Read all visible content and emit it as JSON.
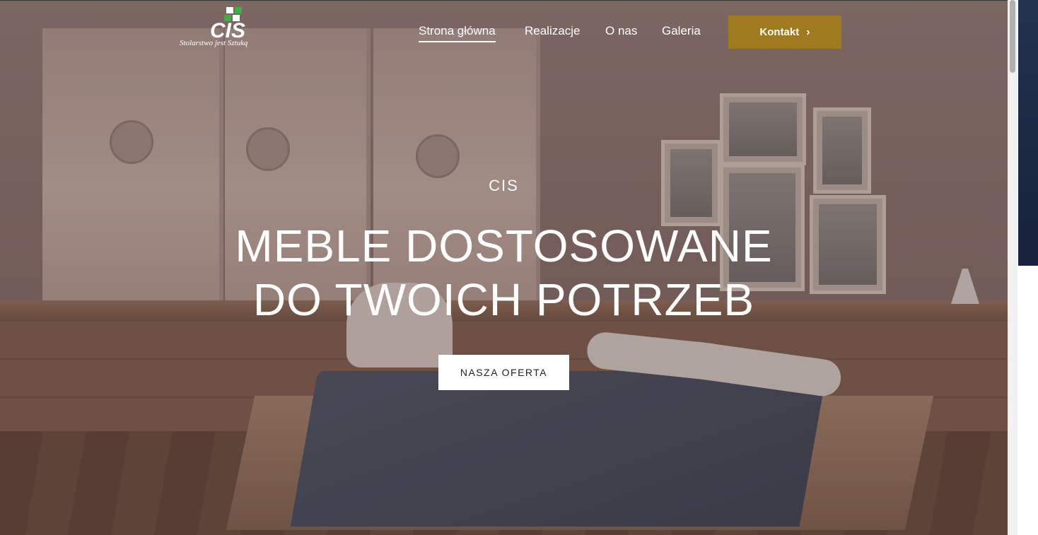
{
  "header": {
    "logo_text": "CIS",
    "logo_tagline": "Stolarstwo jest Sztuką",
    "nav": [
      {
        "label": "Strona główna",
        "active": true
      },
      {
        "label": "Realizacje",
        "active": false
      },
      {
        "label": "O nas",
        "active": false
      },
      {
        "label": "Galeria",
        "active": false
      }
    ],
    "contact_label": "Kontakt",
    "contact_icon": "chevron-right-icon",
    "accent_color": "#a07a1f"
  },
  "hero": {
    "eyebrow": "CIS",
    "headline_line1": "MEBLE DOSTOSOWANE",
    "headline_line2": "DO TWOICH POTRZEB",
    "cta_label": "NASZA OFERTA"
  },
  "scrollbar": {
    "position": 0
  }
}
